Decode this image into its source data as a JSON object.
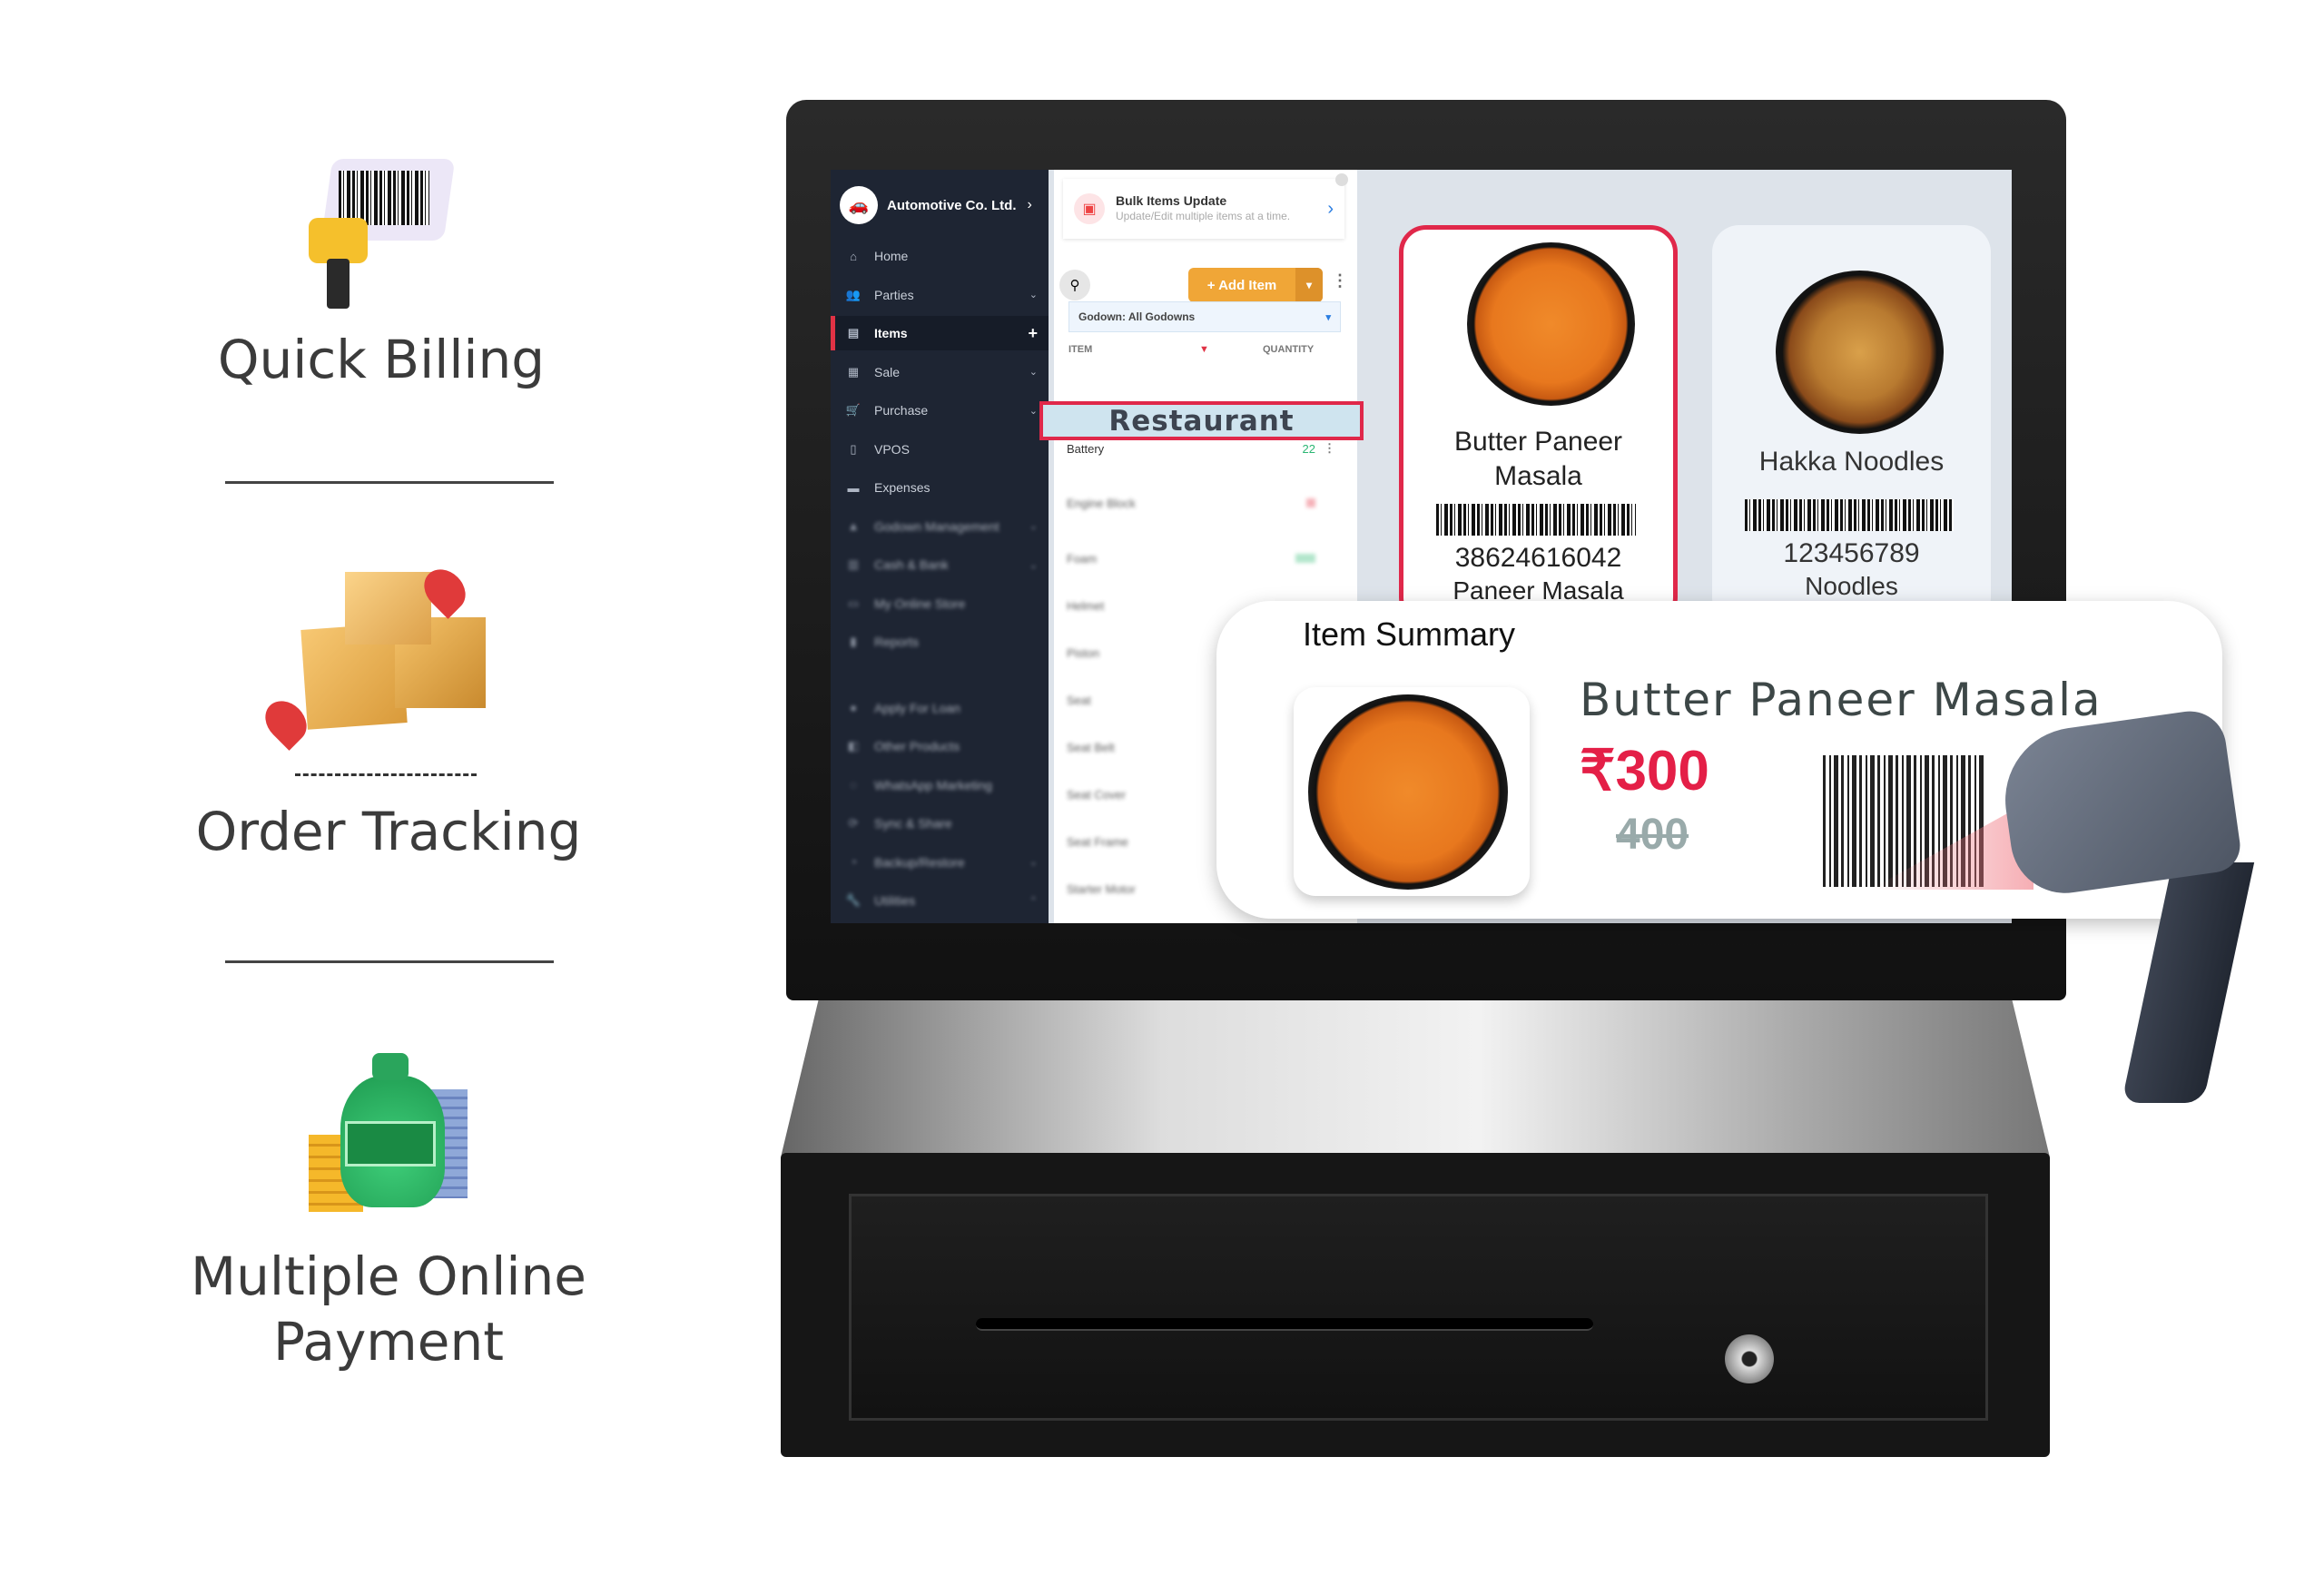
{
  "features": [
    {
      "title": "Quick Billing",
      "icon": "barcode-scanner-icon"
    },
    {
      "title": "Order Tracking",
      "icon": "packages-location-icon"
    },
    {
      "title_line1": "Multiple Online",
      "title_line2": "Payment",
      "icon": "money-bag-icon"
    }
  ],
  "sidebar": {
    "company": "Automotive Co. Ltd.",
    "items": [
      {
        "label": "Home",
        "icon": "home-icon"
      },
      {
        "label": "Parties",
        "icon": "users-icon"
      },
      {
        "label": "Items",
        "icon": "items-icon"
      },
      {
        "label": "Sale",
        "icon": "sale-icon"
      },
      {
        "label": "Purchase",
        "icon": "cart-icon"
      },
      {
        "label": "VPOS",
        "icon": "pos-icon"
      },
      {
        "label": "Expenses",
        "icon": "wallet-icon"
      },
      {
        "label": "Godown Management",
        "icon": "warehouse-icon"
      },
      {
        "label": "Cash & Bank",
        "icon": "bank-icon"
      },
      {
        "label": "My Online Store",
        "icon": "store-icon"
      },
      {
        "label": "Reports",
        "icon": "chart-icon"
      },
      {
        "label": "Apply For Loan",
        "icon": "loan-icon"
      },
      {
        "label": "Other Products",
        "icon": "products-icon"
      },
      {
        "label": "WhatsApp Marketing",
        "icon": "whatsapp-icon"
      },
      {
        "label": "Sync & Share",
        "icon": "sync-icon"
      },
      {
        "label": "Backup/Restore",
        "icon": "backup-icon"
      },
      {
        "label": "Utilities",
        "icon": "wrench-icon"
      }
    ]
  },
  "items_panel": {
    "bulk_title": "Bulk Items Update",
    "bulk_subtitle": "Update/Edit multiple items at a time.",
    "add_item": "+ Add Item",
    "godown": "Godown: All Godowns",
    "col_item": "ITEM",
    "col_quantity": "QUANTITY",
    "category_overlay": "Restaurant",
    "rows": [
      {
        "name": "Battery",
        "qty": "22"
      },
      {
        "name": "Engine Block"
      },
      {
        "name": "Foam"
      },
      {
        "name": "Helmet"
      },
      {
        "name": "Piston"
      },
      {
        "name": "Seat"
      },
      {
        "name": "Seat Belt"
      },
      {
        "name": "Seat Cover"
      },
      {
        "name": "Seat Frame"
      },
      {
        "name": "Starter Motor"
      }
    ]
  },
  "cards": [
    {
      "name": "Butter Paneer Masala",
      "code": "38624616042",
      "sub": "Paneer Masala",
      "selected": true
    },
    {
      "name": "Hakka Noodles",
      "code": "123456789",
      "sub": "Noodles",
      "selected": false
    }
  ],
  "summary": {
    "title": "Item Summary",
    "name": "Butter Paneer Masala",
    "price": "₹300",
    "old_price": "400"
  },
  "colors": {
    "accent": "#e41f47",
    "add_button": "#f0a637",
    "sidebar": "#1e2533"
  }
}
